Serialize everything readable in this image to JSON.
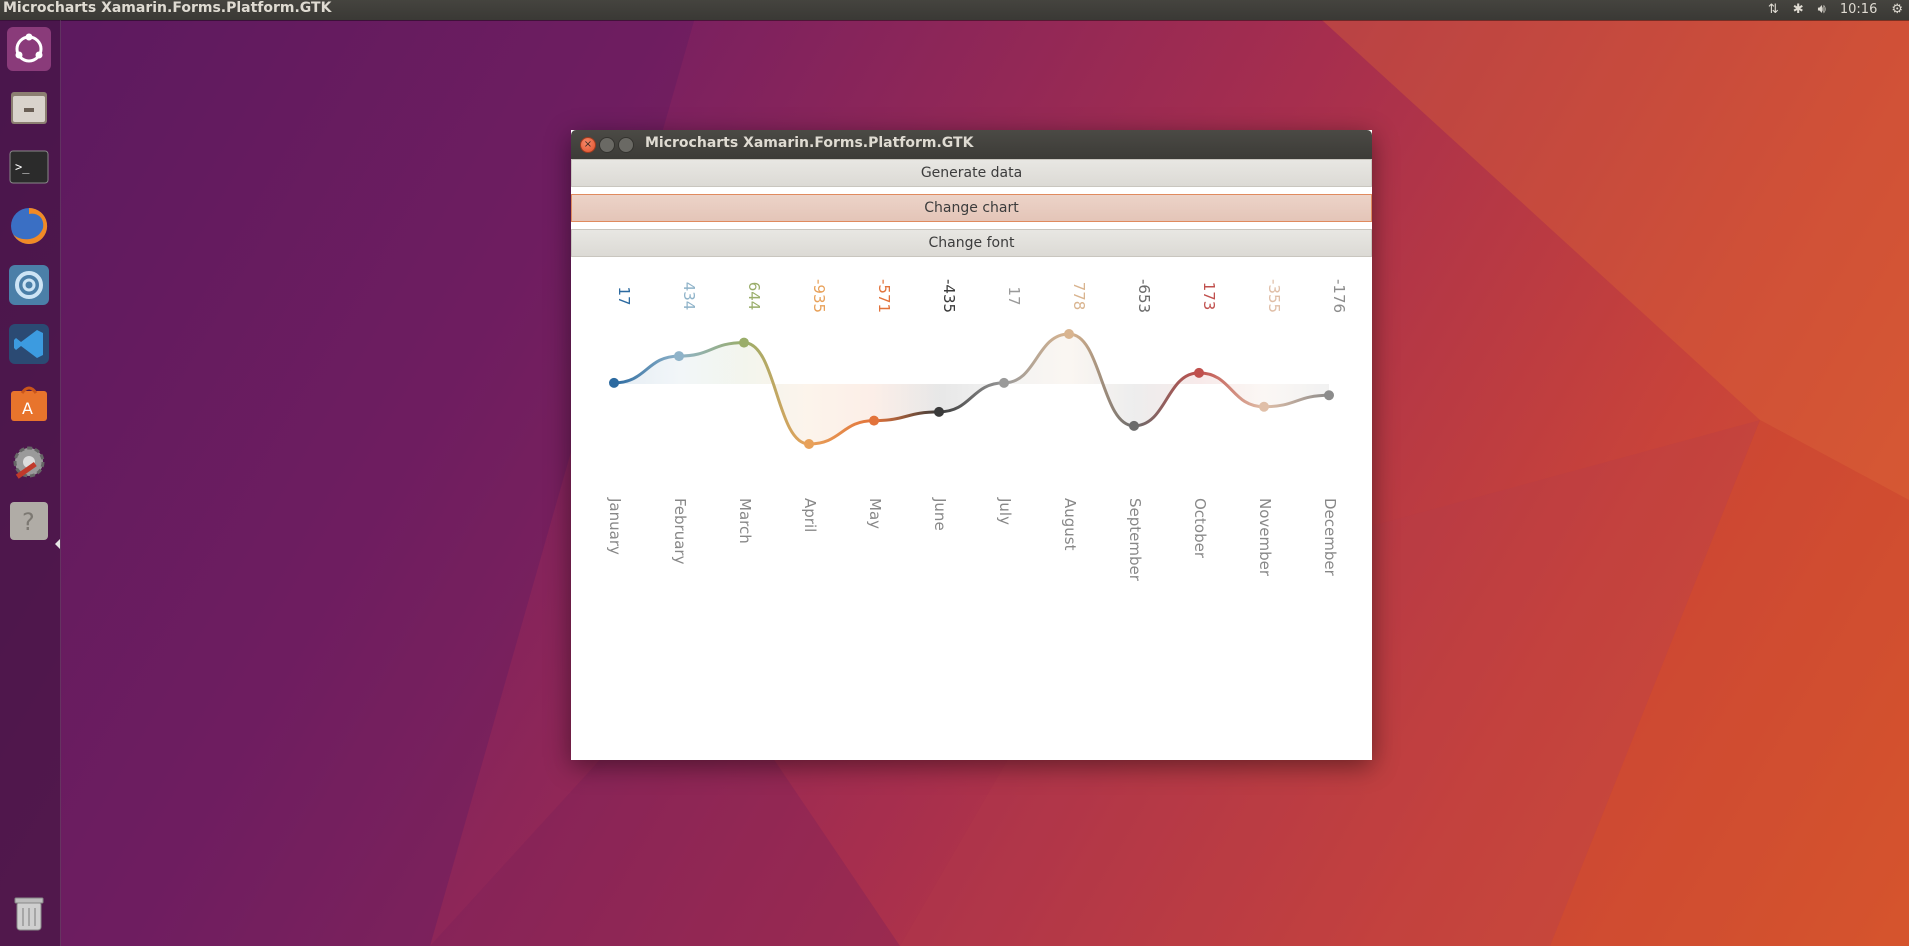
{
  "top_panel": {
    "title": "Microcharts Xamarin.Forms.Platform.GTK",
    "clock": "10:16",
    "indicators": [
      "network-icon",
      "bluetooth-icon",
      "volume-icon",
      "gear-icon"
    ]
  },
  "launcher": {
    "items": [
      "ubuntu-dash-icon",
      "files-icon",
      "terminal-icon",
      "firefox-icon",
      "monodevelop-icon",
      "vscode-icon",
      "software-center-icon",
      "system-settings-icon",
      "help-icon",
      "trash-icon"
    ]
  },
  "window": {
    "title": "Microcharts Xamarin.Forms.Platform.GTK",
    "buttons": {
      "generate": "Generate data",
      "change_chart": "Change chart",
      "change_font": "Change font"
    }
  },
  "chart_data": {
    "type": "line",
    "categories": [
      "January",
      "February",
      "March",
      "April",
      "May",
      "June",
      "July",
      "August",
      "September",
      "October",
      "November",
      "December"
    ],
    "values": [
      17,
      434,
      644,
      -935,
      -571,
      -435,
      17,
      778,
      -653,
      173,
      -355,
      -176
    ],
    "value_labels": [
      "17",
      "434",
      "644",
      "-935",
      "-571",
      "-435",
      "17",
      "778",
      "-653",
      "173",
      "-355",
      "-176"
    ],
    "colors": [
      "#2c6aa0",
      "#8fb3c9",
      "#9aad6a",
      "#e8a15a",
      "#e2733b",
      "#3a3a3a",
      "#9a9a9a",
      "#d9b48f",
      "#6b6b6b",
      "#c0504d",
      "#e0bfa8",
      "#8c8c8c"
    ]
  }
}
